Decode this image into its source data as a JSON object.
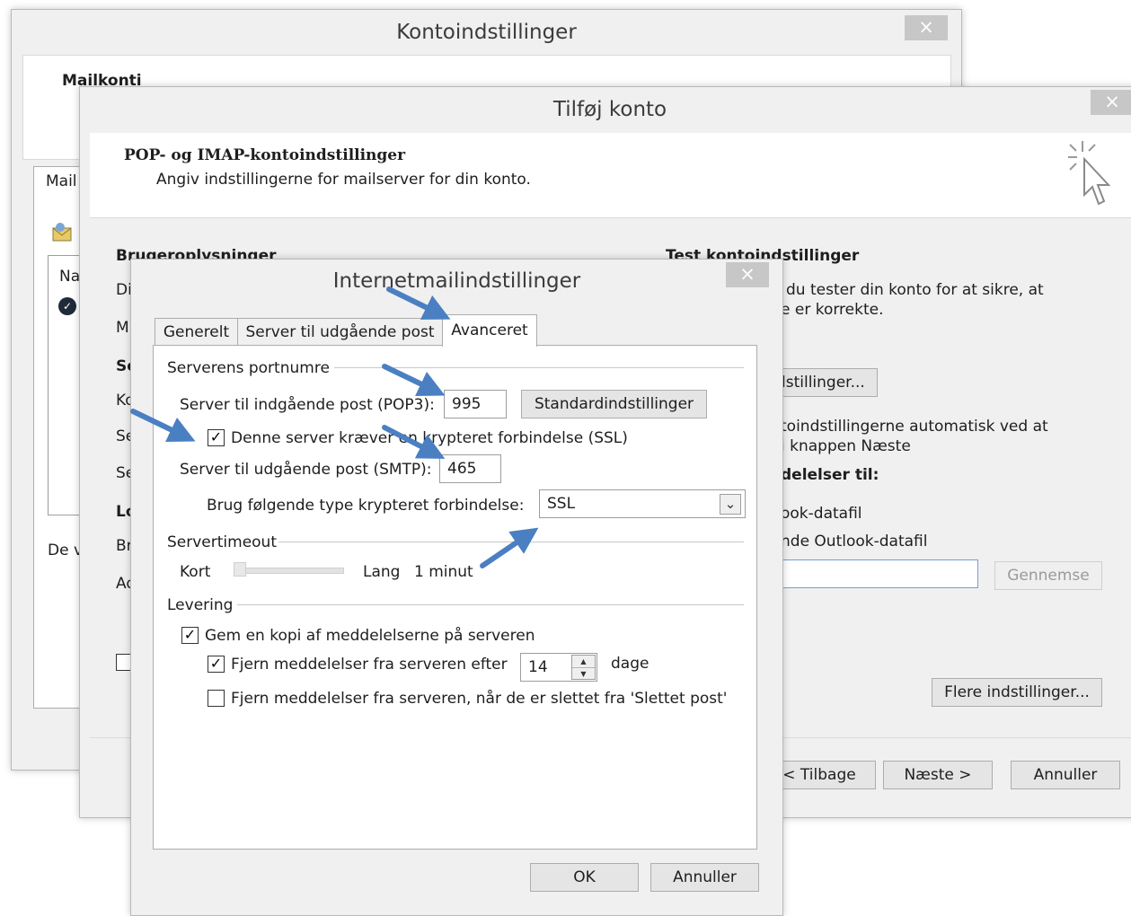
{
  "kontoindstillinger": {
    "title": "Kontoindstillinger",
    "close": "×",
    "mailkonti": "Mailkonti",
    "tab_mail": "Mail",
    "col_na": "Na",
    "de_v": "De v"
  },
  "tilfoej_konto": {
    "title": "Tilføj konto",
    "close": "×",
    "header_title": "POP- og IMAP-kontoindstillinger",
    "header_subtitle": "Angiv indstillingerne for mailserver for din konto.",
    "user_info": "Brugeroplysninger",
    "left_labels": [
      "Di",
      "M",
      "Se",
      "Ko",
      "Se",
      "Se",
      "Lo",
      "Br",
      "Ad"
    ],
    "test_title": "Test kontoindstillinger",
    "test_line1": "du tester din konto for at sikre, at",
    "test_line2": "e er korrekte.",
    "test_button": "lstillinger...",
    "auto_line1": "toindstillingerne automatisk ved at",
    "auto_line2": "i knappen Næste",
    "deliver_label": "delelser til:",
    "datafile_new": "ook-datafil",
    "datafile_existing": "nde Outlook-datafil",
    "browse_button": "Gennemse",
    "more_settings": "Flere indstillinger...",
    "back_button": "< Tilbage",
    "next_button": "Næste >",
    "cancel_button": "Annuller"
  },
  "internet": {
    "title": "Internetmailindstillinger",
    "close": "×",
    "tabs": [
      "Generelt",
      "Server til udgående post",
      "Avanceret"
    ],
    "ports_section": "Serverens portnumre",
    "incoming_label": "Server til indgående post (POP3):",
    "incoming_value": "995",
    "defaults_button": "Standardindstillinger",
    "ssl_required": "Denne server kræver en krypteret forbindelse (SSL)",
    "outgoing_label": "Server til udgående post (SMTP):",
    "outgoing_value": "465",
    "encryption_label": "Brug følgende type krypteret forbindelse:",
    "encryption_value": "SSL",
    "timeout_section": "Servertimeout",
    "short": "Kort",
    "long": "Lang",
    "timeout_value": "1 minut",
    "delivery_section": "Levering",
    "keep_copy": "Gem en kopi af meddelelserne på serveren",
    "remove_after": "Fjern meddelelser fra serveren efter",
    "days_value": "14",
    "days_unit": "dage",
    "remove_deleted": "Fjern meddelelser fra serveren, når de er slettet fra 'Slettet post'",
    "ok_button": "OK",
    "cancel_button": "Annuller",
    "check_mark": "✓",
    "dropdown_glyph": "⌄",
    "spin_up": "▲",
    "spin_down": "▼"
  },
  "colors": {
    "arrow": "#4a7fc2",
    "arrow_outline": "#2f5f9c",
    "close_bg": "#c7c7c7"
  }
}
